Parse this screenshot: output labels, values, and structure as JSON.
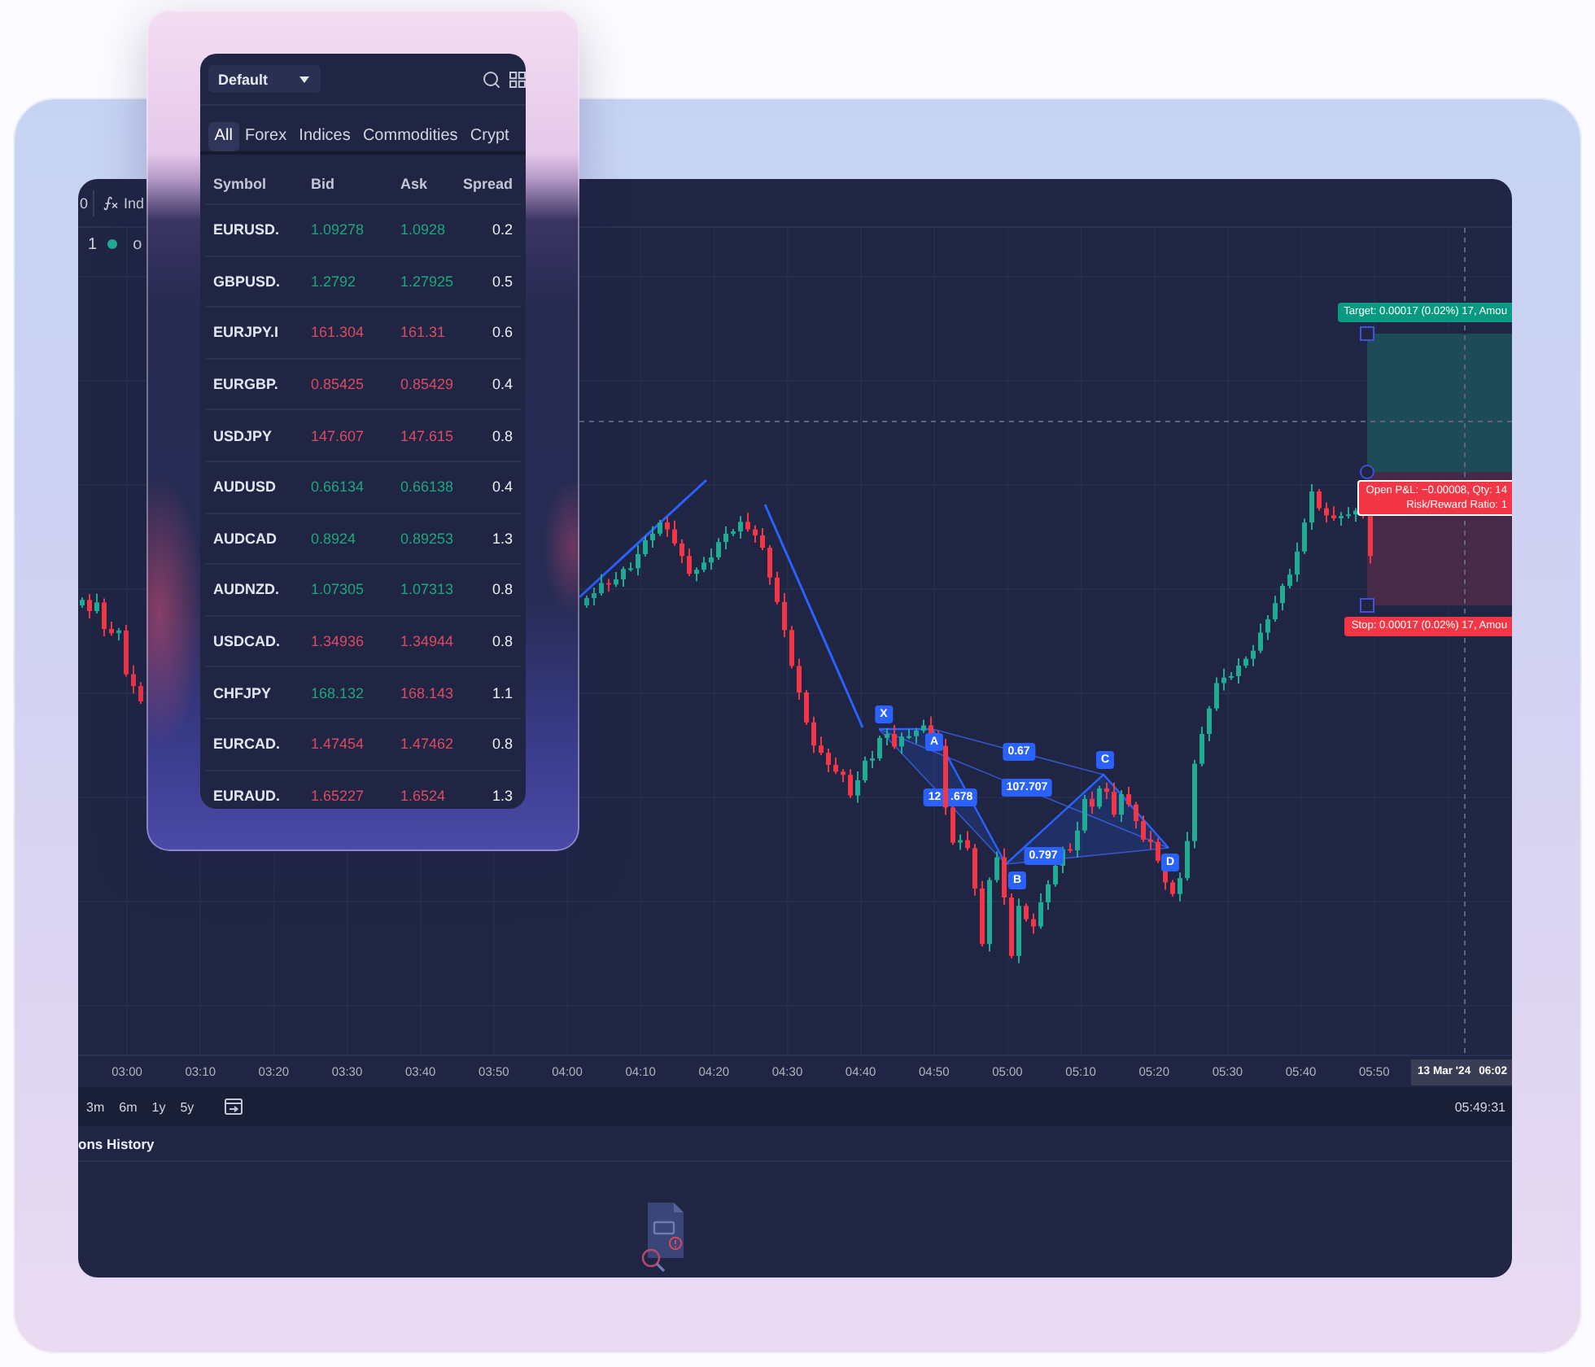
{
  "watchlist": {
    "list_name": "Default",
    "tabs": [
      {
        "label": "All",
        "selected": true
      },
      {
        "label": "Forex",
        "selected": false
      },
      {
        "label": "Indices",
        "selected": false
      },
      {
        "label": "Commodities",
        "selected": false
      },
      {
        "label": "Crypt",
        "selected": false
      }
    ],
    "columns": [
      "Symbol",
      "Bid",
      "Ask",
      "Spread"
    ],
    "rows": [
      {
        "symbol": "EURUSD.",
        "bid": {
          "value": "1.09278",
          "rising": true
        },
        "ask": {
          "value": "1.0928",
          "rising": true
        },
        "spread": "0.2"
      },
      {
        "symbol": "GBPUSD.",
        "bid": {
          "value": "1.2792",
          "rising": true
        },
        "ask": {
          "value": "1.27925",
          "rising": true
        },
        "spread": "0.5"
      },
      {
        "symbol": "EURJPY.I",
        "bid": {
          "value": "161.304",
          "rising": false
        },
        "ask": {
          "value": "161.31",
          "rising": false
        },
        "spread": "0.6"
      },
      {
        "symbol": "EURGBP.",
        "bid": {
          "value": "0.85425",
          "rising": false
        },
        "ask": {
          "value": "0.85429",
          "rising": false
        },
        "spread": "0.4"
      },
      {
        "symbol": "USDJPY",
        "bid": {
          "value": "147.607",
          "rising": false
        },
        "ask": {
          "value": "147.615",
          "rising": false
        },
        "spread": "0.8"
      },
      {
        "symbol": "AUDUSD",
        "bid": {
          "value": "0.66134",
          "rising": true
        },
        "ask": {
          "value": "0.66138",
          "rising": true
        },
        "spread": "0.4"
      },
      {
        "symbol": "AUDCAD",
        "bid": {
          "value": "0.8924",
          "rising": true
        },
        "ask": {
          "value": "0.89253",
          "rising": true
        },
        "spread": "1.3"
      },
      {
        "symbol": "AUDNZD.",
        "bid": {
          "value": "1.07305",
          "rising": true
        },
        "ask": {
          "value": "1.07313",
          "rising": true
        },
        "spread": "0.8"
      },
      {
        "symbol": "USDCAD.",
        "bid": {
          "value": "1.34936",
          "rising": false
        },
        "ask": {
          "value": "1.34944",
          "rising": false
        },
        "spread": "0.8"
      },
      {
        "symbol": "CHFJPY",
        "bid": {
          "value": "168.132",
          "rising": true
        },
        "ask": {
          "value": "168.143",
          "rising": false
        },
        "spread": "1.1"
      },
      {
        "symbol": "EURCAD.",
        "bid": {
          "value": "1.47454",
          "rising": false
        },
        "ask": {
          "value": "1.47462",
          "rising": false
        },
        "spread": "0.8"
      },
      {
        "symbol": "EURAUD.",
        "bid": {
          "value": "1.65227",
          "rising": false
        },
        "ask": {
          "value": "1.6524",
          "rising": false
        },
        "spread": "1.3"
      }
    ]
  },
  "chart_window": {
    "toolbar": {
      "cut_text": "0",
      "indicators_label": "Ind"
    },
    "legend": {
      "number": "1",
      "market_open": true,
      "text": "o"
    },
    "chart": {
      "pattern_points": [
        "X",
        "A",
        "B",
        "C",
        "D"
      ],
      "pattern_ratios": [
        "0.67",
        "107.707",
        "12 .678",
        "0.797"
      ],
      "position": {
        "target": "Target: 0.00017 (0.02%) 17, Amou",
        "open_pnl": "Open P&L: −0.00008, Qty: 14",
        "risk_reward": "Risk/Reward Ratio: 1",
        "stop": "Stop: 0.00017 (0.02%) 17, Amou"
      }
    },
    "time_axis": {
      "labels": [
        "03:00",
        "03:10",
        "03:20",
        "03:30",
        "03:40",
        "03:50",
        "04:00",
        "04:10",
        "04:20",
        "04:30",
        "04:40",
        "04:50",
        "05:00",
        "05:10",
        "05:20",
        "05:30",
        "05:40",
        "05:50"
      ],
      "crosshair_date": "13 Mar '24",
      "crosshair_time": "06:02"
    },
    "range_buttons": [
      "3m",
      "6m",
      "1y",
      "5y"
    ],
    "clock": "05:49:31",
    "bottom_tab": "ons History"
  }
}
